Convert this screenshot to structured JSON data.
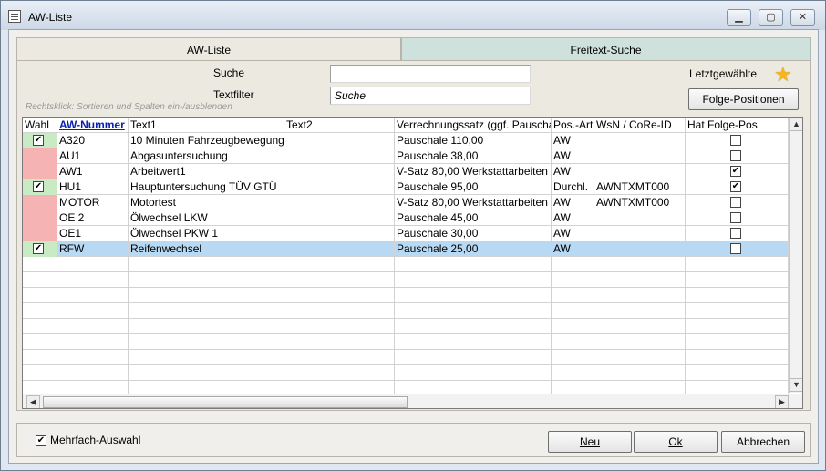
{
  "window": {
    "title": "AW-Liste",
    "controls": [
      "▁",
      "▢",
      "✕"
    ]
  },
  "tabs": {
    "active": "AW-Liste",
    "inactive": "Freitext-Suche"
  },
  "search": {
    "suche_label": "Suche",
    "suche_value": "",
    "textfilter_label": "Textfilter",
    "textfilter_value": "Suche",
    "hint": "Rechtsklick: Sortieren und Spalten ein-/ausblenden",
    "letztgewaehlte_label": "Letztgewählte",
    "folge_button": "Folge-Positionen"
  },
  "grid": {
    "headers": [
      "Wahl",
      "AW-Nummer",
      "Text1",
      "Text2",
      "Verrechnungssatz (ggf. Pauschale)",
      "Pos.-Art",
      "WsN / CoRe-ID",
      "Hat Folge-Pos."
    ],
    "rows": [
      {
        "wahl": "green",
        "checked_wahl": true,
        "nr": "A320",
        "text1": "10 Minuten Fahrzeugbewegung",
        "text2": "",
        "satz": "Pauschale 110,00",
        "art": "AW",
        "wsn": "",
        "folge": false
      },
      {
        "wahl": "red",
        "checked_wahl": false,
        "nr": "AU1",
        "text1": "Abgasuntersuchung",
        "text2": "",
        "satz": "Pauschale 38,00",
        "art": "AW",
        "wsn": "",
        "folge": false
      },
      {
        "wahl": "red",
        "checked_wahl": false,
        "nr": "AW1",
        "text1": "Arbeitwert1",
        "text2": "",
        "satz": "V-Satz 80,00 Werkstattarbeiten",
        "art": "AW",
        "wsn": "",
        "folge": true
      },
      {
        "wahl": "green",
        "checked_wahl": true,
        "nr": "HU1",
        "text1": "Hauptuntersuchung TÜV GTÜ",
        "text2": "",
        "satz": "Pauschale 95,00",
        "art": "Durchl.",
        "wsn": "AWNTXMT000",
        "folge": true
      },
      {
        "wahl": "red",
        "checked_wahl": false,
        "nr": "MOTOR",
        "text1": "Motortest",
        "text2": "",
        "satz": "V-Satz 80,00 Werkstattarbeiten",
        "art": "AW",
        "wsn": "AWNTXMT000",
        "folge": false
      },
      {
        "wahl": "red",
        "checked_wahl": false,
        "nr": "OE 2",
        "text1": "Ölwechsel LKW",
        "text2": "",
        "satz": "Pauschale 45,00",
        "art": "AW",
        "wsn": "",
        "folge": false
      },
      {
        "wahl": "red",
        "checked_wahl": false,
        "nr": "OE1",
        "text1": "Ölwechsel PKW 1",
        "text2": "",
        "satz": "Pauschale 30,00",
        "art": "AW",
        "wsn": "",
        "folge": false
      },
      {
        "wahl": "green",
        "checked_wahl": true,
        "nr": "RFW",
        "text1": "Reifenwechsel",
        "text2": "",
        "satz": "Pauschale 25,00",
        "art": "AW",
        "wsn": "",
        "folge": false
      }
    ]
  },
  "footer": {
    "mehrfach_label": "Mehrfach-Auswahl",
    "mehrfach_checked": true,
    "neu": "Neu",
    "ok": "Ok",
    "abbrechen": "Abbrechen"
  },
  "colors": {
    "wahl_red": "#f6b3b3",
    "wahl_green": "#c8ebc4",
    "selection": "#b7d9f3",
    "header_link": "#0a1fae"
  }
}
